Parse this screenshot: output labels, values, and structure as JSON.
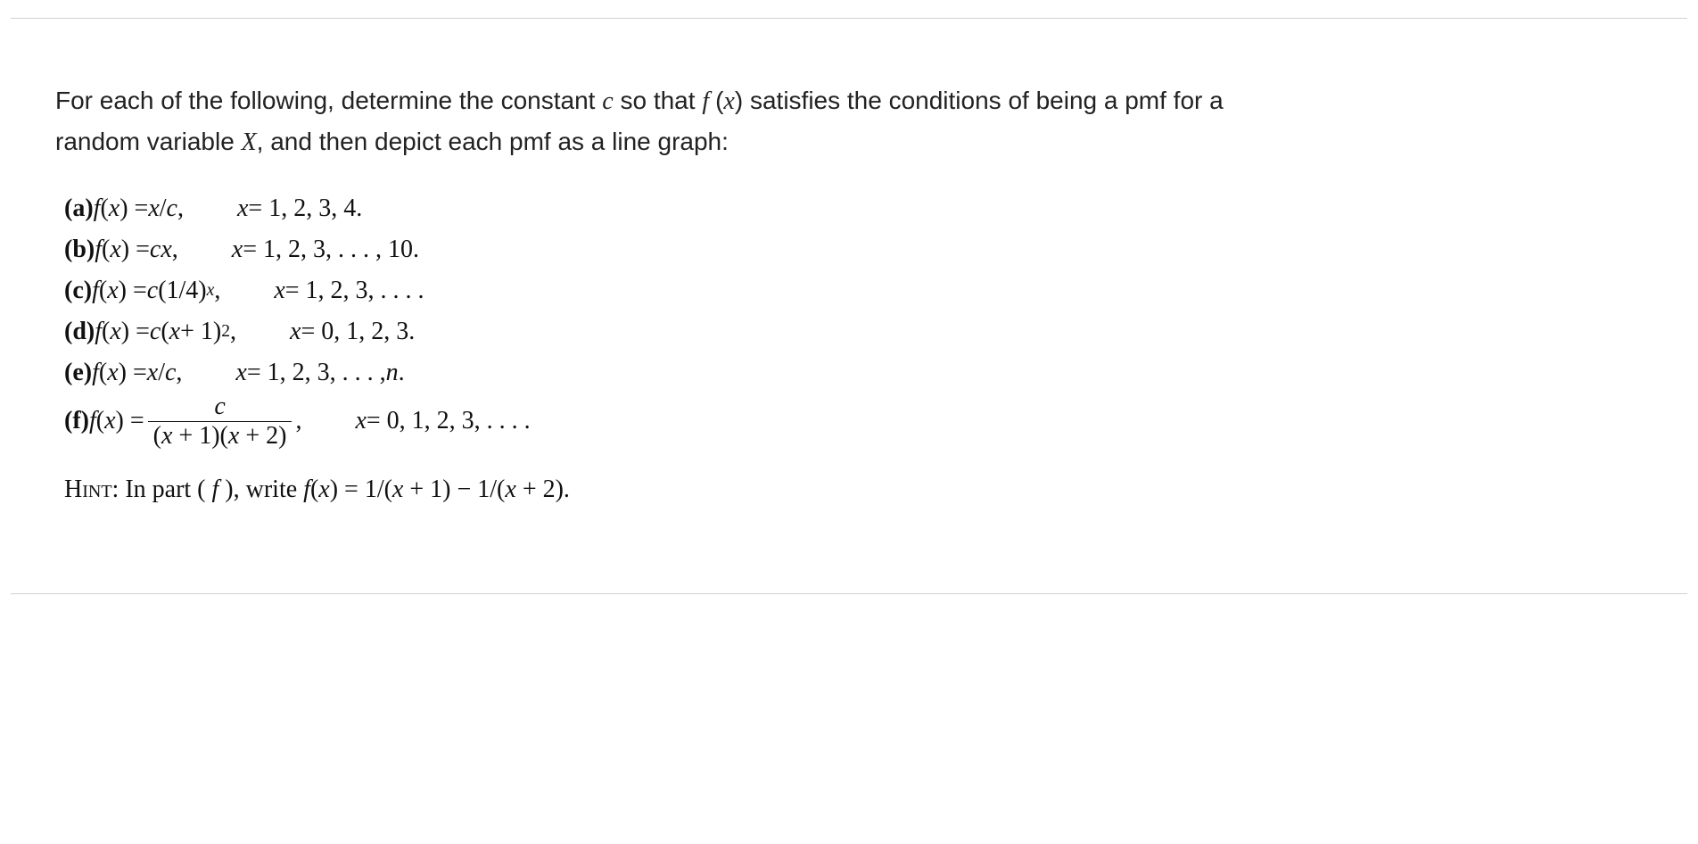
{
  "intro": {
    "part1": "For each of the following, determine the constant ",
    "c": "c",
    "part2": " so that ",
    "f": "f ",
    "openp": "(",
    "x": "x",
    "closep": ")",
    "part3": " satisfies the conditions of being a pmf for a random variable ",
    "X": "X",
    "part4": ", and then depict each pmf as a line graph:"
  },
  "problems": {
    "a": {
      "label": "(a) ",
      "lhs_f": "f",
      "lhs_open": "(",
      "lhs_x": "x",
      "lhs_close": ") = ",
      "rhs": "x",
      "rhs_div": "/",
      "rhs_c": "c",
      "comma": ",",
      "domain_x": "x",
      "domain_eq": " = 1, 2, 3, 4."
    },
    "b": {
      "label": "(b) ",
      "lhs_f": "f",
      "lhs_open": "(",
      "lhs_x": "x",
      "lhs_close": ") = ",
      "rhs_c": "c",
      "rhs_x": "x",
      "comma": ",",
      "domain_x": "x",
      "domain_eq": " = 1, 2, 3, . . . , 10."
    },
    "c": {
      "label": "(c) ",
      "lhs_f": "f",
      "lhs_open": "(",
      "lhs_x": "x",
      "lhs_close": ") = ",
      "rhs_c": "c",
      "rhs_open": "(1/4)",
      "rhs_exp": "x",
      "comma": ",",
      "domain_x": "x",
      "domain_eq": " = 1, 2, 3, . . . ."
    },
    "d": {
      "label": "(d) ",
      "lhs_f": "f",
      "lhs_open": "(",
      "lhs_x": "x",
      "lhs_close": ") = ",
      "rhs_c": "c",
      "rhs_open": "(",
      "rhs_x": "x",
      "rhs_plus": " + 1)",
      "rhs_exp": "2",
      "comma": ",",
      "domain_x": "x",
      "domain_eq": " = 0, 1, 2, 3."
    },
    "e": {
      "label": "(e) ",
      "lhs_f": "f",
      "lhs_open": "(",
      "lhs_x": "x",
      "lhs_close": ") = ",
      "rhs": "x",
      "rhs_div": "/",
      "rhs_c": "c",
      "comma": ",",
      "domain_x": "x",
      "domain_eq": " = 1, 2, 3, . . . , ",
      "domain_n": "n",
      "domain_period": "."
    },
    "f": {
      "label": "(f) ",
      "lhs_f": "f",
      "lhs_open": "(",
      "lhs_x": "x",
      "lhs_close": ") = ",
      "frac_num": "c",
      "frac_den_open": "(",
      "frac_den_x1": "x",
      "frac_den_p1": " + 1)(",
      "frac_den_x2": "x",
      "frac_den_p2": " + 2)",
      "comma": ",",
      "domain_x": "x",
      "domain_eq": " = 0, 1, 2, 3, . . . ."
    }
  },
  "hint": {
    "hint_label": "Hint:",
    "text1": " In part ( ",
    "part_f": "f ",
    "text1b": "), write ",
    "f": "f",
    "open": "(",
    "x": "x",
    "close": ") = 1/(",
    "x2": "x",
    "mid": " + 1) − 1/(",
    "x3": "x",
    "end": " + 2)."
  }
}
